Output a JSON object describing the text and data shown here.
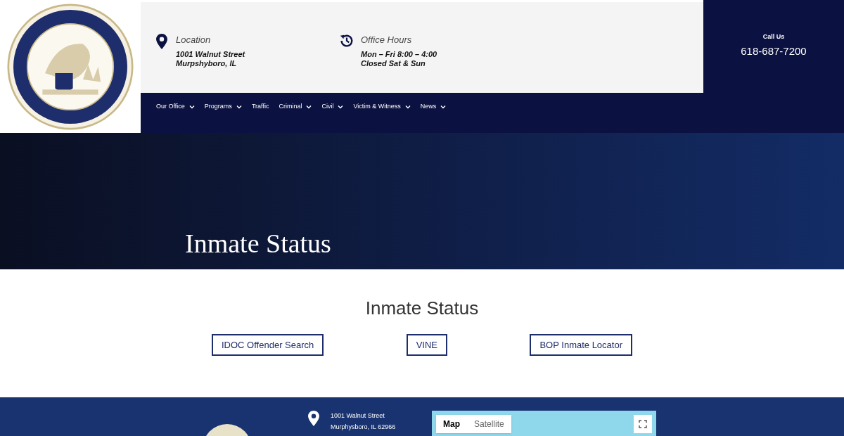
{
  "header": {
    "location": {
      "label": "Location",
      "lines": [
        "1001 Walnut Street",
        "Murpshyboro, IL"
      ]
    },
    "hours": {
      "label": "Office Hours",
      "lines": [
        "Mon – Fri 8:00 – 4:00",
        "Closed Sat & Sun"
      ]
    },
    "call": {
      "label": "Call Us",
      "phone": "618-687-7200"
    }
  },
  "nav": [
    {
      "label": "Our Office",
      "has_menu": true
    },
    {
      "label": "Programs",
      "has_menu": true
    },
    {
      "label": "Traffic",
      "has_menu": false
    },
    {
      "label": "Criminal",
      "has_menu": true
    },
    {
      "label": "Civil",
      "has_menu": true
    },
    {
      "label": "Victim & Witness",
      "has_menu": true
    },
    {
      "label": "News",
      "has_menu": true
    }
  ],
  "hero": {
    "title": "Inmate Status"
  },
  "content": {
    "heading": "Inmate Status",
    "buttons": [
      "IDOC Offender Search",
      "VINE",
      "BOP Inmate Locator"
    ]
  },
  "footer": {
    "address": [
      "1001 Walnut Street",
      "Murphysboro, IL 62966"
    ],
    "map_tabs": [
      {
        "label": "Map",
        "selected": true
      },
      {
        "label": "Satellite",
        "selected": false
      }
    ]
  }
}
